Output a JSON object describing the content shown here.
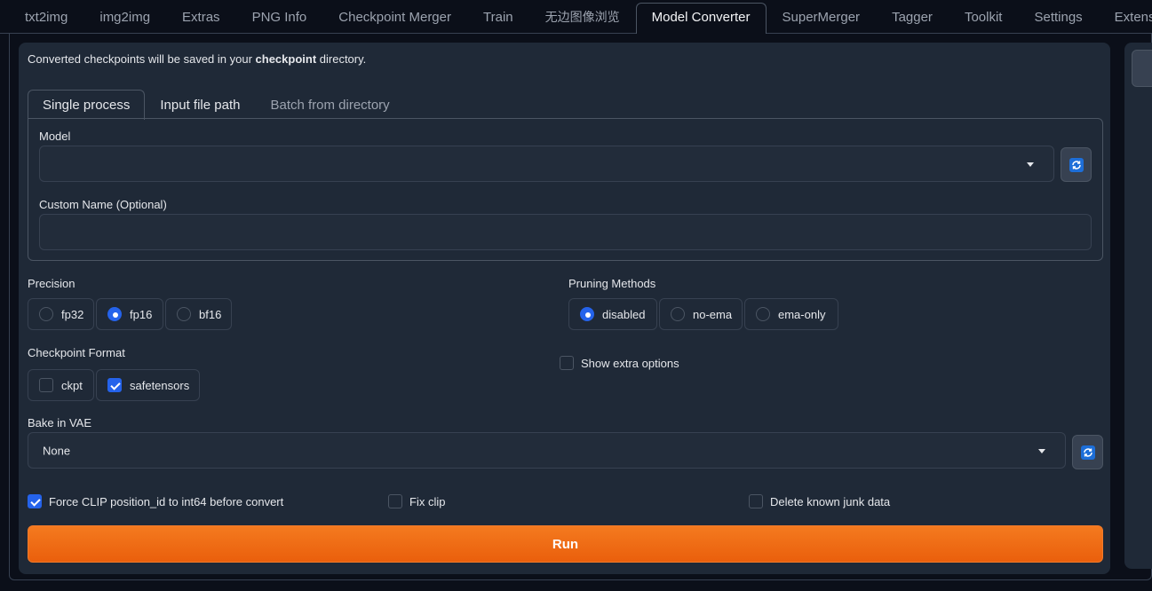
{
  "top_tabs": [
    "txt2img",
    "img2img",
    "Extras",
    "PNG Info",
    "Checkpoint Merger",
    "Train",
    "无边图像浏览",
    "Model Converter",
    "SuperMerger",
    "Tagger",
    "Toolkit",
    "Settings",
    "Extensio"
  ],
  "active_top_tab": "Model Converter",
  "info": {
    "prefix": "Converted checkpoints will be saved in your ",
    "bold": "checkpoint",
    "suffix": " directory."
  },
  "sub_tabs": [
    "Single process",
    "Input file path",
    "Batch from directory"
  ],
  "model": {
    "label": "Model",
    "value": ""
  },
  "custom_name": {
    "label": "Custom Name (Optional)",
    "value": ""
  },
  "precision": {
    "label": "Precision",
    "options": [
      "fp32",
      "fp16",
      "bf16"
    ],
    "selected": "fp16"
  },
  "pruning": {
    "label": "Pruning Methods",
    "options": [
      "disabled",
      "no-ema",
      "ema-only"
    ],
    "selected": "disabled"
  },
  "checkpoint_format": {
    "label": "Checkpoint Format",
    "options": [
      {
        "label": "ckpt",
        "checked": false
      },
      {
        "label": "safetensors",
        "checked": true
      }
    ]
  },
  "show_extra": {
    "label": "Show extra options",
    "checked": false
  },
  "bake_vae": {
    "label": "Bake in VAE",
    "value": "None"
  },
  "force_clip": {
    "label": "Force CLIP position_id to int64 before convert",
    "checked": true
  },
  "fix_clip": {
    "label": "Fix clip",
    "checked": false
  },
  "delete_junk": {
    "label": "Delete known junk data",
    "checked": false
  },
  "run_label": "Run",
  "colors": {
    "accent": "#2563eb",
    "run_button": "#ea5f0c",
    "refresh_icon": "#1d6ed8",
    "background": "#0b0f19",
    "panel": "#1f2937"
  },
  "icons": {
    "refresh": "refresh-icon",
    "dropdown": "chevron-down-icon"
  }
}
